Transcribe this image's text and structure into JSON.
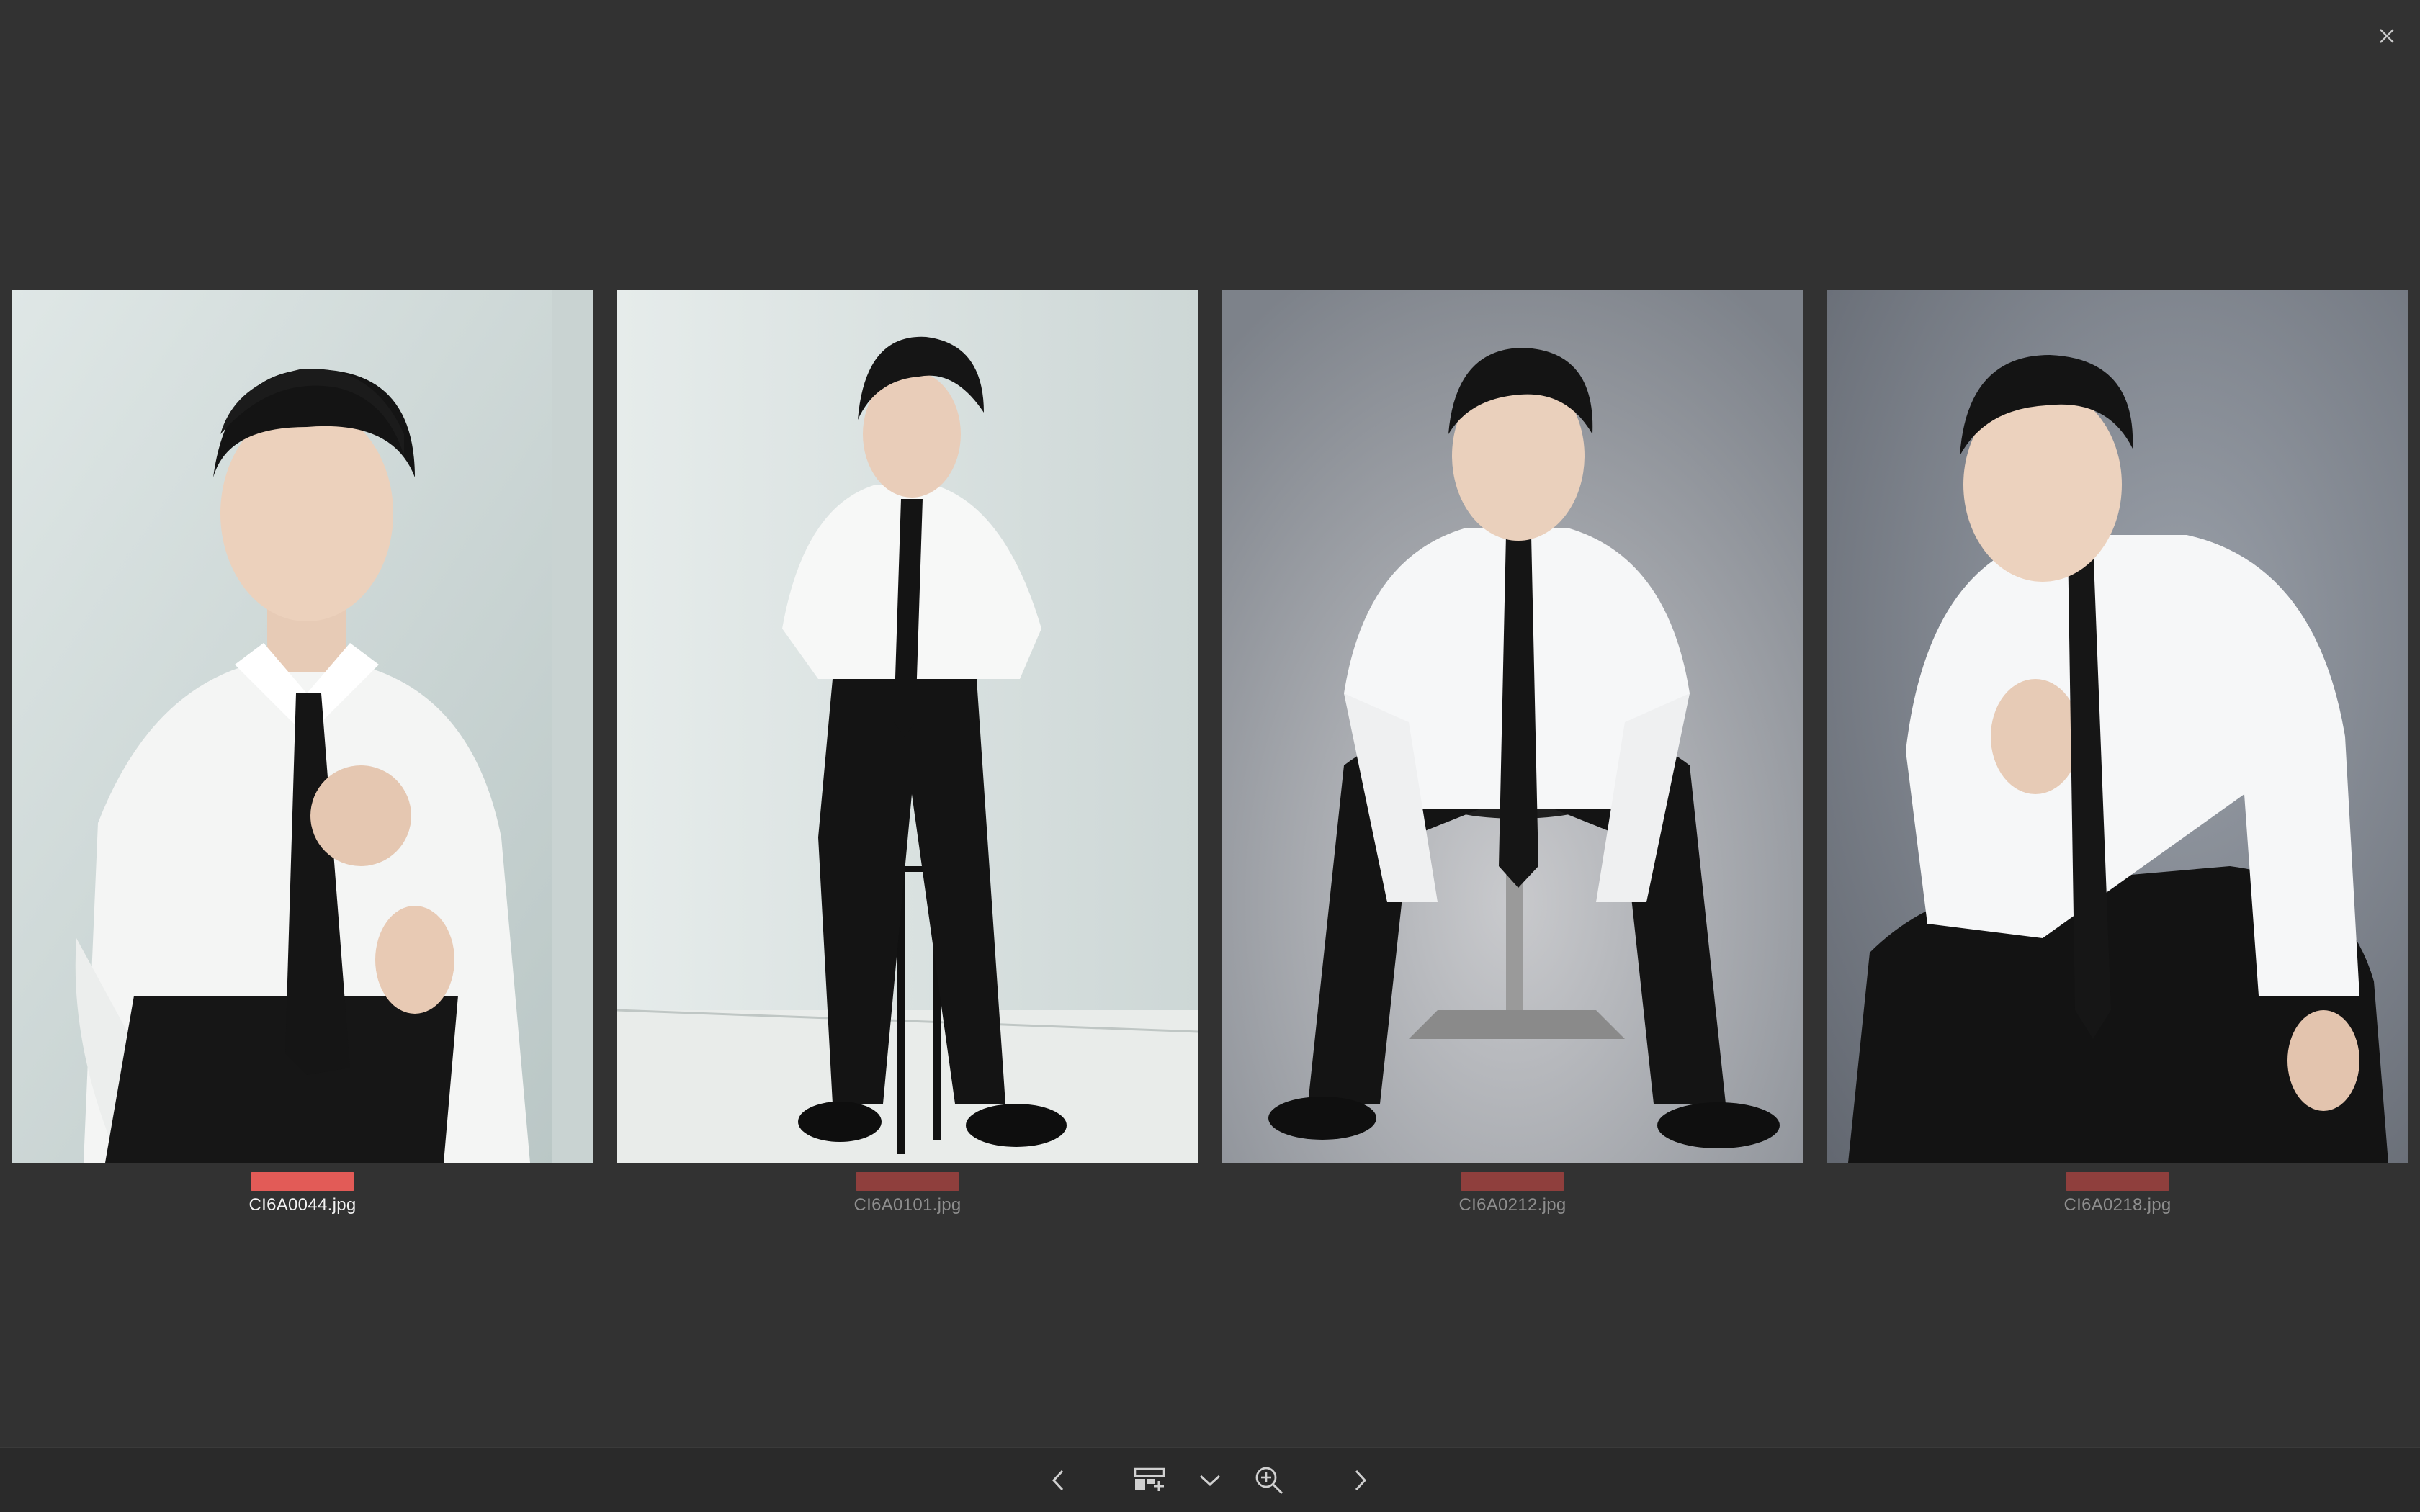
{
  "colors": {
    "background": "#323232",
    "toolbar": "#2a2a2a",
    "label_selected": "#e25b57",
    "label_unselected": "#8f3f3d",
    "text_selected": "#f2f2f2",
    "text_unselected": "#8e8e8e"
  },
  "header": {
    "close_icon": "close-icon"
  },
  "images": [
    {
      "filename": "CI6A0044.jpg",
      "label_color": "#e25b57",
      "selected": true
    },
    {
      "filename": "CI6A0101.jpg",
      "label_color": "#8f3f3d",
      "selected": false
    },
    {
      "filename": "CI6A0212.jpg",
      "label_color": "#8f3f3d",
      "selected": false
    },
    {
      "filename": "CI6A0218.jpg",
      "label_color": "#8f3f3d",
      "selected": false
    }
  ],
  "toolbar": {
    "items": [
      {
        "icon": "chevron-left-icon",
        "name": "previous"
      },
      {
        "icon": "compare-layout-icon",
        "name": "layout"
      },
      {
        "icon": "chevron-down-icon",
        "name": "layout-dropdown"
      },
      {
        "icon": "zoom-in-icon",
        "name": "zoom"
      },
      {
        "icon": "chevron-right-icon",
        "name": "next"
      }
    ]
  }
}
